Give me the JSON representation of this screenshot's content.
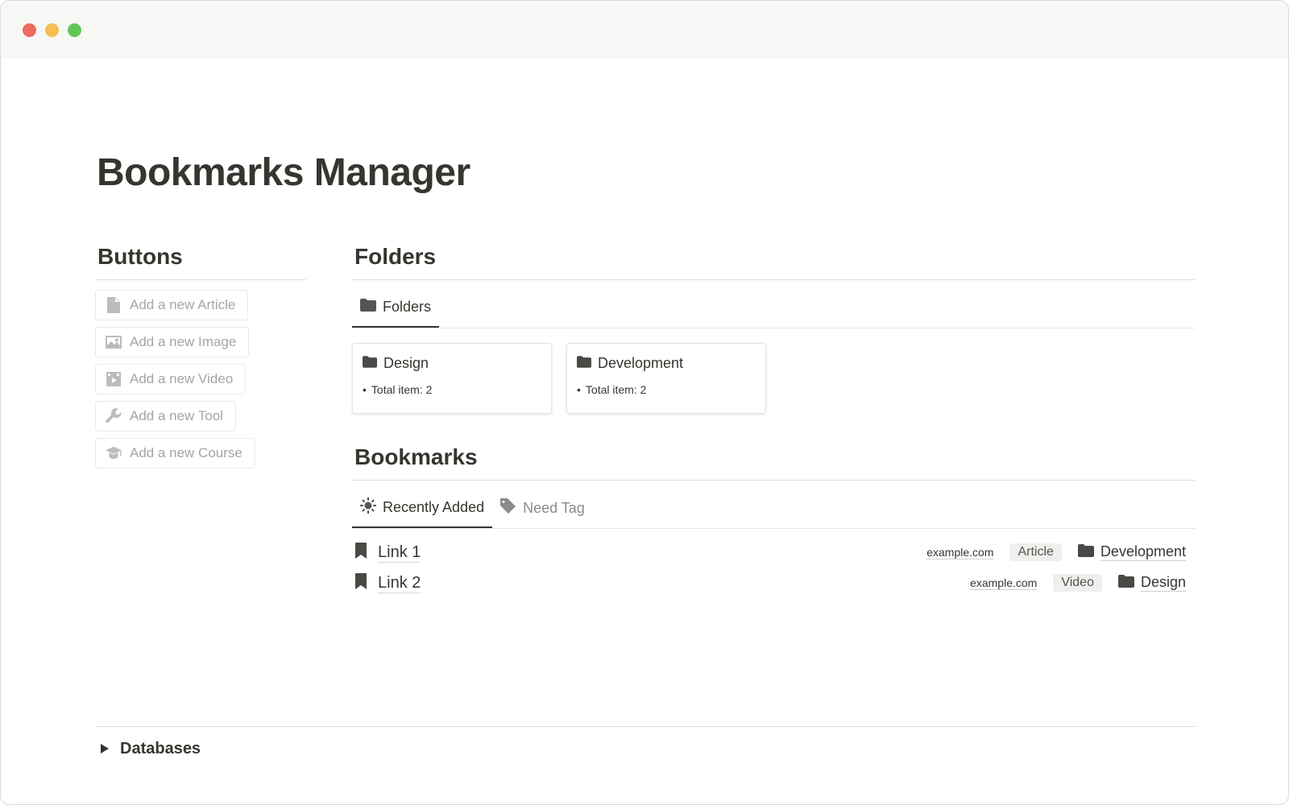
{
  "page": {
    "title": "Bookmarks Manager"
  },
  "buttons": {
    "heading": "Buttons",
    "items": [
      {
        "label": "Add a new Article",
        "icon": "document-icon"
      },
      {
        "label": "Add a new Image",
        "icon": "image-icon"
      },
      {
        "label": "Add a new Video",
        "icon": "video-icon"
      },
      {
        "label": "Add a new Tool",
        "icon": "wrench-icon"
      },
      {
        "label": "Add a new Course",
        "icon": "graduation-cap-icon"
      }
    ]
  },
  "folders": {
    "heading": "Folders",
    "tab_label": "Folders",
    "cards": [
      {
        "name": "Design",
        "meta": "Total item: 2"
      },
      {
        "name": "Development",
        "meta": "Total item: 2"
      }
    ]
  },
  "bookmarks": {
    "heading": "Bookmarks",
    "tabs": [
      {
        "label": "Recently Added",
        "icon": "sun-icon",
        "active": true
      },
      {
        "label": "Need Tag",
        "icon": "tag-icon",
        "active": false
      }
    ],
    "items": [
      {
        "name": "Link 1",
        "domain": "example.com",
        "type": "Article",
        "folder": "Development"
      },
      {
        "name": "Link 2",
        "domain": "example.com",
        "type": "Video",
        "folder": "Design"
      }
    ]
  },
  "databases": {
    "label": "Databases"
  },
  "colors": {
    "traffic_red": "#ed6a5e",
    "traffic_yellow": "#f5bf4f",
    "traffic_green": "#61c554",
    "text": "#37352f",
    "muted_text": "#a6a5a2"
  }
}
